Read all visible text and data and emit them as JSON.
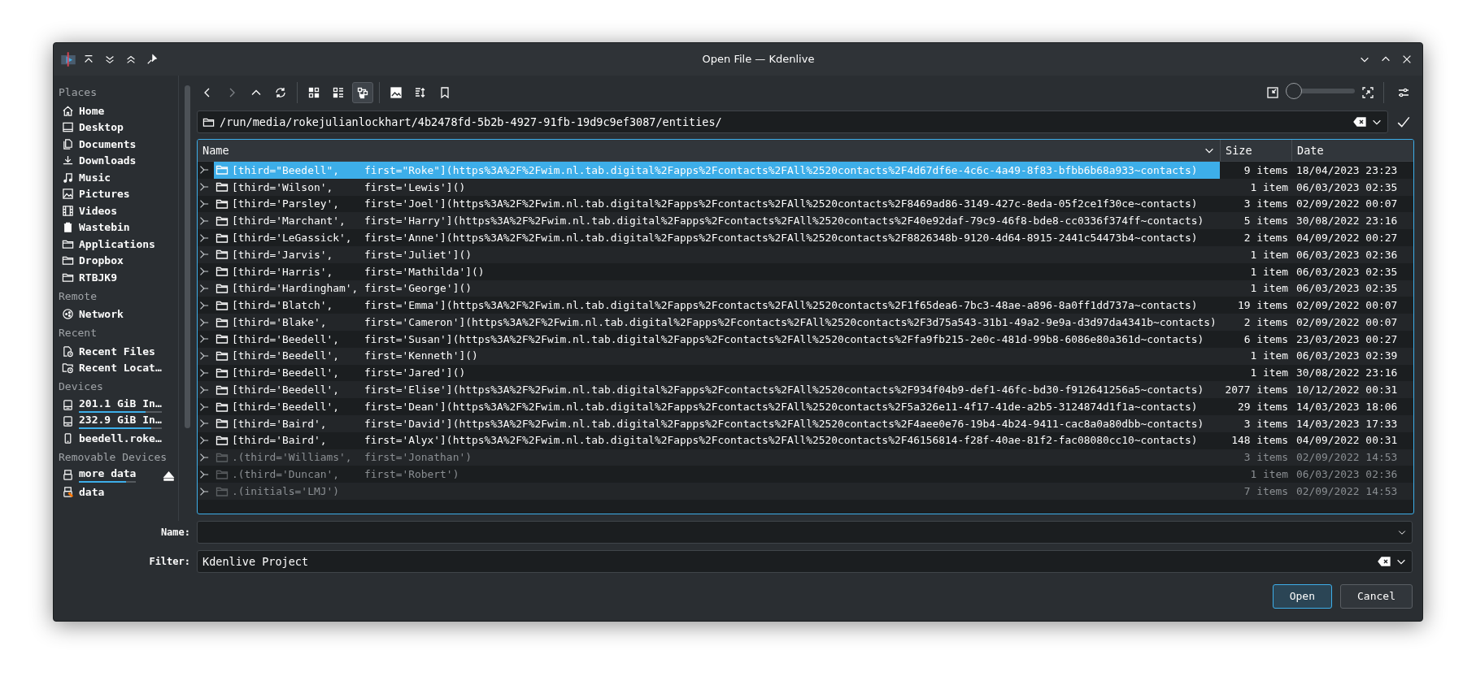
{
  "window": {
    "title": "Open File — Kdenlive"
  },
  "sidebar": {
    "sections": [
      {
        "heading": "Places",
        "items": [
          {
            "label": "Home",
            "kind": "home"
          },
          {
            "label": "Desktop",
            "kind": "desktop"
          },
          {
            "label": "Documents",
            "kind": "documents"
          },
          {
            "label": "Downloads",
            "kind": "downloads"
          },
          {
            "label": "Music",
            "kind": "music"
          },
          {
            "label": "Pictures",
            "kind": "pictures"
          },
          {
            "label": "Videos",
            "kind": "videos"
          },
          {
            "label": "Wastebin",
            "kind": "trash"
          },
          {
            "label": "Applications",
            "kind": "folder"
          },
          {
            "label": "Dropbox",
            "kind": "folder"
          },
          {
            "label": "RTBJK9",
            "kind": "folder"
          }
        ]
      },
      {
        "heading": "Remote",
        "items": [
          {
            "label": "Network",
            "kind": "network"
          }
        ]
      },
      {
        "heading": "Recent",
        "items": [
          {
            "label": "Recent Files",
            "kind": "recent-file"
          },
          {
            "label": "Recent Locat…",
            "kind": "recent-folder"
          }
        ]
      },
      {
        "heading": "Devices",
        "items": [
          {
            "label": "201.1 GiB In…",
            "kind": "drive",
            "level": 0.81
          },
          {
            "label": "232.9 GiB In…",
            "kind": "drive",
            "level": 0.87
          },
          {
            "label": "beedell.roke…",
            "kind": "phone"
          }
        ]
      },
      {
        "heading": "Removable Devices",
        "items": [
          {
            "label": "more data",
            "kind": "usb",
            "level": 0.82,
            "ejectable": true
          },
          {
            "label": "data",
            "kind": "usb-warning"
          }
        ]
      }
    ]
  },
  "toolbar": {
    "groups": [
      {
        "buttons": [
          {
            "kind": "back",
            "selected": false,
            "disabled": false
          },
          {
            "kind": "forward",
            "selected": false,
            "disabled": true
          },
          {
            "kind": "up",
            "selected": false,
            "disabled": false
          },
          {
            "kind": "reload",
            "selected": false,
            "disabled": false
          }
        ]
      },
      {
        "buttons": [
          {
            "kind": "icons-view",
            "selected": false,
            "disabled": false
          },
          {
            "kind": "compact-view",
            "selected": false,
            "disabled": false
          },
          {
            "kind": "tree-view",
            "selected": true,
            "disabled": false
          }
        ]
      },
      {
        "buttons": [
          {
            "kind": "preview",
            "selected": false,
            "disabled": false
          },
          {
            "kind": "sort",
            "selected": false,
            "disabled": false
          },
          {
            "kind": "bookmark",
            "selected": false,
            "disabled": false
          }
        ]
      }
    ],
    "zoom_slider": {
      "level": 0
    }
  },
  "path": {
    "value": "/run/media/rokejulianlockhart/4b2478fd-5b2b-4927-91fb-19d9c9ef3087/entities/"
  },
  "table": {
    "columns": [
      "Name",
      "Size",
      "Date"
    ],
    "rows": [
      {
        "name": "[third=\"Beedell\",    first=\"Roke\"](https%3A%2F%2Fwim.nl.tab.digital%2Fapps%2Fcontacts%2FAll%2520contacts%2F4d67df6e-4c6c-4a49-8f83-bfbb6b68a933~contacts)",
        "size": "9 items",
        "date": "18/04/2023 23:23",
        "selected": true,
        "hidden": false
      },
      {
        "name": "[third='Wilson',     first='Lewis']()",
        "size": "1 item",
        "date": "06/03/2023 02:35",
        "selected": false,
        "hidden": false
      },
      {
        "name": "[third='Parsley',    first='Joel'](https%3A%2F%2Fwim.nl.tab.digital%2Fapps%2Fcontacts%2FAll%2520contacts%2F8469ad86-3149-427c-8eda-05f2ce1f30ce~contacts)",
        "size": "3 items",
        "date": "02/09/2022 00:07",
        "selected": false,
        "hidden": false
      },
      {
        "name": "[third='Marchant',   first='Harry'](https%3A%2F%2Fwim.nl.tab.digital%2Fapps%2Fcontacts%2FAll%2520contacts%2F40e92daf-79c9-46f8-bde8-cc0336f374ff~contacts)",
        "size": "5 items",
        "date": "30/08/2022 23:16",
        "selected": false,
        "hidden": false
      },
      {
        "name": "[third='LeGassick',  first='Anne'](https%3A%2F%2Fwim.nl.tab.digital%2Fapps%2Fcontacts%2FAll%2520contacts%2F8826348b-9120-4d64-8915-2441c54473b4~contacts)",
        "size": "2 items",
        "date": "04/09/2022 00:27",
        "selected": false,
        "hidden": false
      },
      {
        "name": "[third='Jarvis',     first='Juliet']()",
        "size": "1 item",
        "date": "06/03/2023 02:36",
        "selected": false,
        "hidden": false
      },
      {
        "name": "[third='Harris',     first='Mathilda']()",
        "size": "1 item",
        "date": "06/03/2023 02:35",
        "selected": false,
        "hidden": false
      },
      {
        "name": "[third='Hardingham', first='George']()",
        "size": "1 item",
        "date": "06/03/2023 02:35",
        "selected": false,
        "hidden": false
      },
      {
        "name": "[third='Blatch',     first='Emma'](https%3A%2F%2Fwim.nl.tab.digital%2Fapps%2Fcontacts%2FAll%2520contacts%2F1f65dea6-7bc3-48ae-a896-8a0ff1dd737a~contacts)",
        "size": "19 items",
        "date": "02/09/2022 00:07",
        "selected": false,
        "hidden": false
      },
      {
        "name": "[third='Blake',      first='Cameron'](https%3A%2F%2Fwim.nl.tab.digital%2Fapps%2Fcontacts%2FAll%2520contacts%2F3d75a543-31b1-49a2-9e9a-d3d97da4341b~contacts)",
        "size": "2 items",
        "date": "02/09/2022 00:07",
        "selected": false,
        "hidden": false
      },
      {
        "name": "[third='Beedell',    first='Susan'](https%3A%2F%2Fwim.nl.tab.digital%2Fapps%2Fcontacts%2FAll%2520contacts%2Ffa9fb215-2e0c-481d-99b8-6086e80a361d~contacts)",
        "size": "6 items",
        "date": "23/03/2023 00:27",
        "selected": false,
        "hidden": false
      },
      {
        "name": "[third='Beedell',    first='Kenneth']()",
        "size": "1 item",
        "date": "06/03/2023 02:39",
        "selected": false,
        "hidden": false
      },
      {
        "name": "[third='Beedell',    first='Jared']()",
        "size": "1 item",
        "date": "30/08/2022 23:16",
        "selected": false,
        "hidden": false
      },
      {
        "name": "[third='Beedell',    first='Elise'](https%3A%2F%2Fwim.nl.tab.digital%2Fapps%2Fcontacts%2FAll%2520contacts%2F934f04b9-def1-46fc-bd30-f912641256a5~contacts)",
        "size": "2077 items",
        "date": "10/12/2022 00:31",
        "selected": false,
        "hidden": false
      },
      {
        "name": "[third='Beedell',    first='Dean'](https%3A%2F%2Fwim.nl.tab.digital%2Fapps%2Fcontacts%2FAll%2520contacts%2F5a326e11-4f17-41de-a2b5-3124874d1f1a~contacts)",
        "size": "29 items",
        "date": "14/03/2023 18:06",
        "selected": false,
        "hidden": false
      },
      {
        "name": "[third='Baird',      first='David'](https%3A%2F%2Fwim.nl.tab.digital%2Fapps%2Fcontacts%2FAll%2520contacts%2F4aee0e76-19b4-4b24-9411-cac8a0a80dbb~contacts)",
        "size": "3 items",
        "date": "14/03/2023 17:33",
        "selected": false,
        "hidden": false
      },
      {
        "name": "[third='Baird',      first='Alyx'](https%3A%2F%2Fwim.nl.tab.digital%2Fapps%2Fcontacts%2FAll%2520contacts%2F46156814-f28f-40ae-81f2-fac08080cc10~contacts)",
        "size": "148 items",
        "date": "04/09/2022 00:31",
        "selected": false,
        "hidden": false
      },
      {
        "name": ".(third='Williams',  first='Jonathan')",
        "size": "3 items",
        "date": "02/09/2022 14:53",
        "selected": false,
        "hidden": true
      },
      {
        "name": ".(third='Duncan',    first='Robert')",
        "size": "1 item",
        "date": "06/03/2023 02:36",
        "selected": false,
        "hidden": true
      },
      {
        "name": ".(initials='LMJ')",
        "size": "7 items",
        "date": "02/09/2022 14:53",
        "selected": false,
        "hidden": true
      }
    ]
  },
  "name_field": {
    "label": "Name:"
  },
  "filter": {
    "label": "Filter:",
    "value": "Kdenlive Project"
  },
  "buttons": [
    {
      "label": "Open",
      "default": true
    },
    {
      "label": "Cancel",
      "default": false
    }
  ]
}
